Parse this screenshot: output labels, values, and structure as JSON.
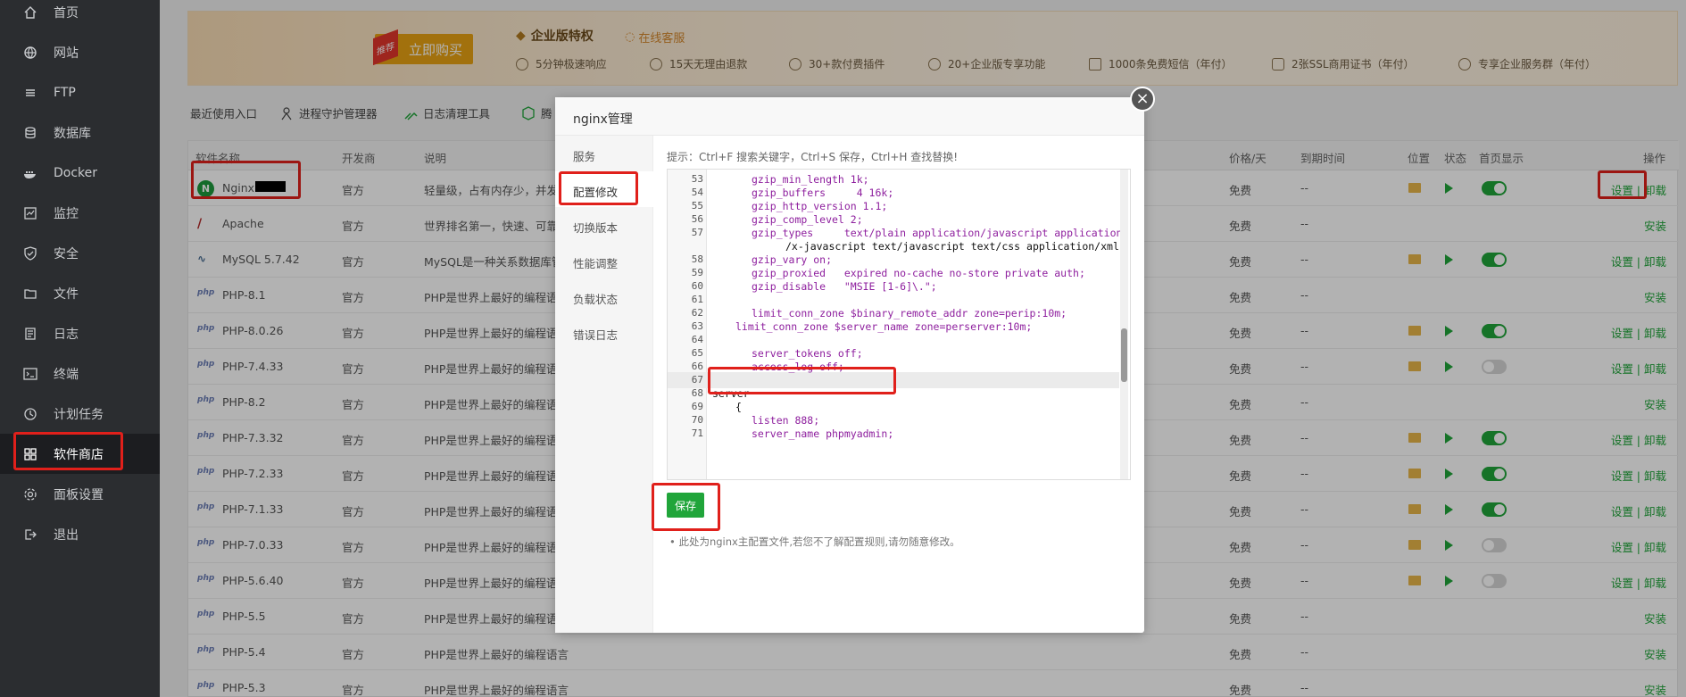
{
  "sidebar": {
    "items": [
      {
        "label": "首页",
        "icon": "home-icon"
      },
      {
        "label": "网站",
        "icon": "globe-icon"
      },
      {
        "label": "FTP",
        "icon": "ftp-icon"
      },
      {
        "label": "数据库",
        "icon": "database-icon"
      },
      {
        "label": "Docker",
        "icon": "docker-icon"
      },
      {
        "label": "监控",
        "icon": "monitor-icon"
      },
      {
        "label": "安全",
        "icon": "shield-icon"
      },
      {
        "label": "文件",
        "icon": "folder-icon"
      },
      {
        "label": "日志",
        "icon": "log-icon"
      },
      {
        "label": "终端",
        "icon": "terminal-icon"
      },
      {
        "label": "计划任务",
        "icon": "clock-icon"
      },
      {
        "label": "软件商店",
        "icon": "grid-icon"
      },
      {
        "label": "面板设置",
        "icon": "gear-icon"
      },
      {
        "label": "退出",
        "icon": "logout-icon"
      }
    ],
    "active_index": 11
  },
  "banner": {
    "buy_tag": "推荐",
    "buy_label": "立即购买",
    "enterprise_title": "企业版特权",
    "online_service": "在线客服",
    "features": [
      "5分钟极速响应",
      "15天无理由退款",
      "30+款付费插件",
      "20+企业版专享功能",
      "1000条免费短信（年付）",
      "2张SSL商用证书（年付）",
      "专享企业服务群（年付）"
    ]
  },
  "quick_bar": {
    "label": "最近使用入口",
    "items": [
      "进程守护管理器",
      "日志清理工具",
      "腾"
    ]
  },
  "table": {
    "headers": {
      "name": "软件名称",
      "developer": "开发商",
      "desc": "说明",
      "price": "价格/天",
      "expire": "到期时间",
      "location": "位置",
      "status": "状态",
      "home": "首页显示",
      "ops": "操作"
    },
    "rows": [
      {
        "name": "Nginx",
        "dev": "官方",
        "desc": "轻量级，占有内存少，并发能",
        "price": "免费",
        "expire": "--",
        "installed": true,
        "home": true,
        "action": "设置 | 卸载",
        "logo": "N"
      },
      {
        "name": "Apache",
        "dev": "官方",
        "desc": "世界排名第一，快速、可靠并",
        "price": "免费",
        "expire": "--",
        "installed": false,
        "action": "安装",
        "logo": "A"
      },
      {
        "name": "MySQL 5.7.42",
        "dev": "官方",
        "desc": "MySQL是一种关系数据库管",
        "price": "免费",
        "expire": "--",
        "installed": true,
        "home": true,
        "action": "设置 | 卸载",
        "logo": "M"
      },
      {
        "name": "PHP-8.1",
        "dev": "官方",
        "desc": "PHP是世界上最好的编程语言",
        "price": "免费",
        "expire": "--",
        "installed": false,
        "action": "安装",
        "logo": "php"
      },
      {
        "name": "PHP-8.0.26",
        "dev": "官方",
        "desc": "PHP是世界上最好的编程语言",
        "price": "免费",
        "expire": "--",
        "installed": true,
        "home": true,
        "action": "设置 | 卸载",
        "logo": "php"
      },
      {
        "name": "PHP-7.4.33",
        "dev": "官方",
        "desc": "PHP是世界上最好的编程语言",
        "price": "免费",
        "expire": "--",
        "installed": true,
        "home": false,
        "action": "设置 | 卸载",
        "logo": "php"
      },
      {
        "name": "PHP-8.2",
        "dev": "官方",
        "desc": "PHP是世界上最好的编程语言",
        "price": "免费",
        "expire": "--",
        "installed": false,
        "action": "安装",
        "logo": "php"
      },
      {
        "name": "PHP-7.3.32",
        "dev": "官方",
        "desc": "PHP是世界上最好的编程语言",
        "price": "免费",
        "expire": "--",
        "installed": true,
        "home": true,
        "action": "设置 | 卸载",
        "logo": "php"
      },
      {
        "name": "PHP-7.2.33",
        "dev": "官方",
        "desc": "PHP是世界上最好的编程语言",
        "price": "免费",
        "expire": "--",
        "installed": true,
        "home": true,
        "action": "设置 | 卸载",
        "logo": "php"
      },
      {
        "name": "PHP-7.1.33",
        "dev": "官方",
        "desc": "PHP是世界上最好的编程语言",
        "price": "免费",
        "expire": "--",
        "installed": true,
        "home": true,
        "action": "设置 | 卸载",
        "logo": "php"
      },
      {
        "name": "PHP-7.0.33",
        "dev": "官方",
        "desc": "PHP是世界上最好的编程语言",
        "price": "免费",
        "expire": "--",
        "installed": true,
        "home": false,
        "action": "设置 | 卸载",
        "logo": "php"
      },
      {
        "name": "PHP-5.6.40",
        "dev": "官方",
        "desc": "PHP是世界上最好的编程语言",
        "price": "免费",
        "expire": "--",
        "installed": true,
        "home": false,
        "action": "设置 | 卸载",
        "logo": "php"
      },
      {
        "name": "PHP-5.5",
        "dev": "官方",
        "desc": "PHP是世界上最好的编程语言",
        "price": "免费",
        "expire": "--",
        "installed": false,
        "action": "安装",
        "logo": "php"
      },
      {
        "name": "PHP-5.4",
        "dev": "官方",
        "desc": "PHP是世界上最好的编程语言",
        "price": "免费",
        "expire": "--",
        "installed": false,
        "action": "安装",
        "logo": "php"
      },
      {
        "name": "PHP-5.3",
        "dev": "官方",
        "desc": "PHP是世界上最好的编程语言",
        "price": "免费",
        "expire": "--",
        "installed": false,
        "action": "安装",
        "logo": "php"
      }
    ]
  },
  "modal": {
    "title": "nginx管理",
    "tabs": [
      "服务",
      "配置修改",
      "切换版本",
      "性能调整",
      "负载状态",
      "错误日志"
    ],
    "active_tab": 1,
    "hint": "提示：Ctrl+F 搜索关键字，Ctrl+S 保存，Ctrl+H 查找替换!",
    "save_label": "保存",
    "note": "此处为nginx主配置文件,若您不了解配置规则,请勿随意修改。",
    "close_icon": "close-icon",
    "code_lines": [
      {
        "n": "53",
        "text": "gzip_min_length 1k;"
      },
      {
        "n": "54",
        "text": "gzip_buffers     4 16k;"
      },
      {
        "n": "55",
        "text": "gzip_http_version 1.1;"
      },
      {
        "n": "56",
        "text": "gzip_comp_level 2;"
      },
      {
        "n": "57",
        "text": "gzip_types     text/plain application/javascript application"
      },
      {
        "n": "",
        "text": "/x-javascript text/javascript text/css application/xml;"
      },
      {
        "n": "58",
        "text": "gzip_vary on;"
      },
      {
        "n": "59",
        "text": "gzip_proxied   expired no-cache no-store private auth;"
      },
      {
        "n": "60",
        "text": "gzip_disable   \"MSIE [1-6]\\.\";"
      },
      {
        "n": "61",
        "text": ""
      },
      {
        "n": "62",
        "text": "limit_conn_zone $binary_remote_addr zone=perip:10m;"
      },
      {
        "n": "63",
        "text": "limit_conn_zone $server_name zone=perserver:10m;"
      },
      {
        "n": "64",
        "text": ""
      },
      {
        "n": "65",
        "text": "server_tokens off;"
      },
      {
        "n": "66",
        "text": "access_log off;"
      },
      {
        "n": "67",
        "text": ""
      },
      {
        "n": "68",
        "text": "server"
      },
      {
        "n": "69",
        "text": "{"
      },
      {
        "n": "70",
        "text": "listen 888;"
      },
      {
        "n": "71",
        "text": "server_name phpmyadmin;"
      }
    ]
  },
  "colors": {
    "accent": "#20a53a",
    "sidebar_bg": "#2b2d30",
    "highlight_box": "#e0201b",
    "buy_button": "#e8a313"
  }
}
